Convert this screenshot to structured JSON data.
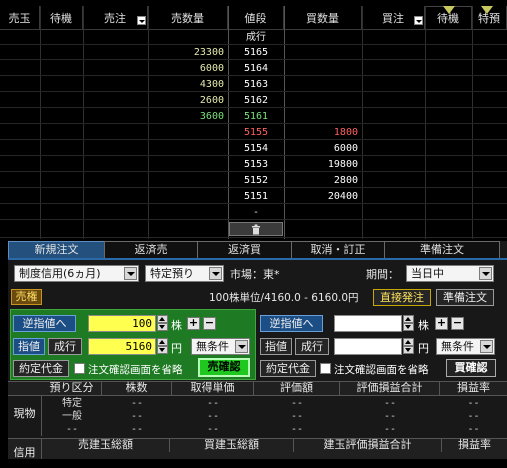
{
  "board": {
    "headers": {
      "uri_gyoku": "売玉",
      "taiki_left": "待機",
      "sell_order": "売注",
      "sell_qty": "売数量",
      "price": "値段",
      "buy_qty": "買数量",
      "buy_order": "買注",
      "taiki_right": "待機",
      "tokutei": "特預"
    },
    "nari_label": "成行",
    "rows": [
      {
        "sell_qty": "23300",
        "price": "5165",
        "buy_qty": "",
        "sell_color": "#e8e8b0",
        "price_color": "#ffffff",
        "buy_color": "#ffffff"
      },
      {
        "sell_qty": "6000",
        "price": "5164",
        "buy_qty": "",
        "sell_color": "#e8e8b0",
        "price_color": "#ffffff",
        "buy_color": "#ffffff"
      },
      {
        "sell_qty": "4300",
        "price": "5163",
        "buy_qty": "",
        "sell_color": "#e8e8b0",
        "price_color": "#ffffff",
        "buy_color": "#ffffff"
      },
      {
        "sell_qty": "2600",
        "price": "5162",
        "buy_qty": "",
        "sell_color": "#e8e8b0",
        "price_color": "#ffffff",
        "buy_color": "#ffffff"
      },
      {
        "sell_qty": "3600",
        "price": "5161",
        "buy_qty": "",
        "sell_color": "#7ee07e",
        "price_color": "#7ee07e",
        "buy_color": "#ffffff"
      },
      {
        "sell_qty": "",
        "price": "5155",
        "buy_qty": "1800",
        "sell_color": "#ffffff",
        "price_color": "#ff6060",
        "buy_color": "#ff6060"
      },
      {
        "sell_qty": "",
        "price": "5154",
        "buy_qty": "6000",
        "sell_color": "#ffffff",
        "price_color": "#ffffff",
        "buy_color": "#ffffff"
      },
      {
        "sell_qty": "",
        "price": "5153",
        "buy_qty": "19800",
        "sell_color": "#ffffff",
        "price_color": "#ffffff",
        "buy_color": "#ffffff"
      },
      {
        "sell_qty": "",
        "price": "5152",
        "buy_qty": "2800",
        "sell_color": "#ffffff",
        "price_color": "#ffffff",
        "buy_color": "#ffffff"
      },
      {
        "sell_qty": "",
        "price": "5151",
        "buy_qty": "20400",
        "sell_color": "#ffffff",
        "price_color": "#ffffff",
        "buy_color": "#ffffff"
      }
    ],
    "dash": "-",
    "trash_icon": "trash-icon"
  },
  "tabs": [
    "新規注文",
    "返済売",
    "返済買",
    "取消・訂正",
    "準備注文"
  ],
  "order": {
    "margin_type": "制度信用(6ヵ月)",
    "account_type": "特定預り",
    "market_label": "市場：",
    "market_value": "東*",
    "period_label": "期間：",
    "period_value": "当日中",
    "sell_label": "売権",
    "unit_info": "100株単位/4160.0 - 6160.0円",
    "direct_btn": "直接発注",
    "prep_btn": "準備注文",
    "sell": {
      "stop_btn": "逆指値へ",
      "qty": "100",
      "qty_unit": "株",
      "limit_btn": "指値",
      "market_btn": "成行",
      "price": "5160",
      "price_unit": "円",
      "condition": "無条件",
      "contract_btn": "約定代金",
      "confirm_label": "注文確認画面を省略",
      "confirm_btn": "売確認"
    },
    "buy": {
      "stop_btn": "逆指値へ",
      "qty": "",
      "qty_unit": "株",
      "limit_btn": "指値",
      "market_btn": "成行",
      "price": "",
      "price_unit": "円",
      "condition": "無条件",
      "contract_btn": "約定代金",
      "confirm_label": "注文確認画面を省略",
      "confirm_btn": "買確認"
    }
  },
  "positions": {
    "headers": [
      "預り区分",
      "株数",
      "取得単価",
      "評価額",
      "評価損益合計",
      "損益率"
    ],
    "row_label": "現物",
    "rows": [
      {
        "kubun": "特定",
        "shares": "--",
        "cost": "--",
        "value": "--",
        "pl": "--",
        "rate": "--"
      },
      {
        "kubun": "一般",
        "shares": "--",
        "cost": "--",
        "value": "--",
        "pl": "--",
        "rate": "--"
      },
      {
        "kubun": "--",
        "shares": "--",
        "cost": "--",
        "value": "--",
        "pl": "--",
        "rate": "--"
      }
    ],
    "credit_label": "信用",
    "credit_headers": [
      "売建玉総額",
      "買建玉総額",
      "建玉評価損益合計",
      "損益率"
    ]
  },
  "colors": {
    "accent_blue": "#24507d",
    "sell_panel": "#1f7a24",
    "sell_highlight": "#1fc81f",
    "price_red": "#ff6060",
    "price_green": "#7ee07e"
  }
}
